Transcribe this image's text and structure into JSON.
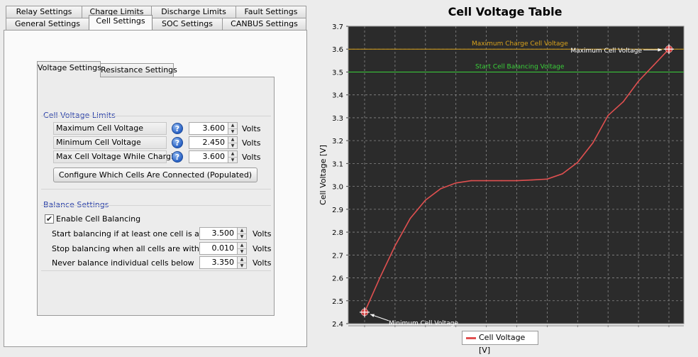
{
  "tabs_row1": [
    "Relay Settings",
    "Charge Limits",
    "Discharge Limits",
    "Fault Settings"
  ],
  "tabs_row2": [
    "General Settings",
    "Cell Settings",
    "SOC Settings",
    "CANBUS Settings"
  ],
  "inner_tabs": [
    "Voltage Settings",
    "Resistance Settings"
  ],
  "cell_voltage_limits": {
    "title": "Cell Voltage Limits",
    "rows": [
      {
        "label": "Maximum Cell Voltage",
        "value": "3.600",
        "unit": "Volts"
      },
      {
        "label": "Minimum Cell Voltage",
        "value": "2.450",
        "unit": "Volts"
      },
      {
        "label": "Max Cell Voltage While Charging",
        "value": "3.600",
        "unit": "Volts"
      }
    ],
    "help_glyph": "?",
    "configure_button": "Configure Which Cells Are Connected (Populated)"
  },
  "balance_settings": {
    "title": "Balance Settings",
    "enable_label": "Enable Cell Balancing",
    "enabled": true,
    "rows": [
      {
        "label": "Start balancing if at least one cell is above",
        "value": "3.500",
        "unit": "Volts"
      },
      {
        "label": "Stop balancing when all cells are within",
        "value": "0.010",
        "unit": "Volts"
      },
      {
        "label": "Never balance individual cells below",
        "value": "3.350",
        "unit": "Volts"
      }
    ]
  },
  "chart_data": {
    "type": "line",
    "title": "Cell Voltage Table",
    "ylabel": "Cell Voltage [V]",
    "xlabel": "",
    "ylim": [
      2.4,
      3.7
    ],
    "yticks": [
      "2.4",
      "2.5",
      "2.6",
      "2.7",
      "2.8",
      "2.9",
      "3.0",
      "3.1",
      "3.2",
      "3.3",
      "3.4",
      "3.5",
      "3.6",
      "3.7"
    ],
    "x": [
      0,
      5,
      10,
      15,
      20,
      25,
      30,
      35,
      40,
      45,
      50,
      55,
      60,
      65,
      70,
      75,
      80,
      85,
      90,
      95,
      100
    ],
    "series": [
      {
        "name": "Cell Voltage [V]",
        "color": "#e05050",
        "values": [
          2.45,
          2.6,
          2.74,
          2.86,
          2.94,
          2.99,
          3.015,
          3.025,
          3.025,
          3.025,
          3.025,
          3.028,
          3.032,
          3.055,
          3.105,
          3.19,
          3.31,
          3.37,
          3.46,
          3.53,
          3.6
        ]
      }
    ],
    "reference_lines": [
      {
        "label": "Maximum Charge Cell Voltage",
        "value": 3.6,
        "color": "#d9a21b"
      },
      {
        "label": "Start Cell Balancing Voltage",
        "value": 3.5,
        "color": "#3ad13a"
      }
    ],
    "annotations": [
      {
        "label": "Maximum Cell Voltage",
        "x": 100,
        "y": 3.6
      },
      {
        "label": "Minimum Cell Voltage",
        "x": 0,
        "y": 2.45
      }
    ],
    "background": "#2b2b2b",
    "grid": true,
    "legend": "bottom-center"
  }
}
